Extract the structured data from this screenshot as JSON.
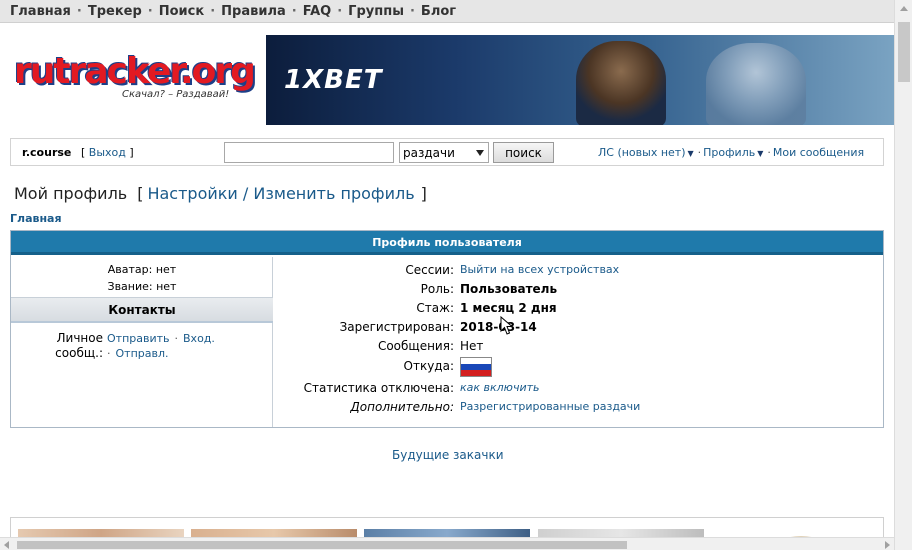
{
  "topnav": {
    "items": [
      "Главная",
      "Трекер",
      "Поиск",
      "Правила",
      "FAQ",
      "Группы",
      "Блог"
    ],
    "separator": "·"
  },
  "logo": {
    "brand": "rutracker.org",
    "slogan": "Скачал? – Раздавай!"
  },
  "banner": {
    "text": "1XBET"
  },
  "searchbar": {
    "username": "r.course",
    "logout_open": "[",
    "logout_label": "Выход",
    "logout_close": "]",
    "query_value": "",
    "scope_value": "раздачи",
    "search_button": "поиск",
    "pm_link": "ЛС (новых нет)",
    "profile_link": "Профиль",
    "messages_link": "Мои сообщения"
  },
  "page": {
    "title": "Мой профиль",
    "settings_link": "Настройки / Изменить профиль",
    "breadcrumb": "Главная"
  },
  "profile": {
    "header": "Профиль пользователя",
    "avatar": "Аватар: нет",
    "rank": "Звание: нет",
    "contacts_header": "Контакты",
    "pm_label": "Личное сообщ.:",
    "pm_send": "Отправить",
    "pm_inbox": "Вход.",
    "pm_sent": "Отправл.",
    "rows": [
      {
        "key": "Сессии:",
        "value": "Выйти на всех устройствах"
      },
      {
        "key": "Роль:",
        "value": "Пользователь"
      },
      {
        "key": "Стаж:",
        "value": "1 месяц 2 дня"
      },
      {
        "key": "Зарегистрирован:",
        "value": "2018-03-14"
      },
      {
        "key": "Сообщения:",
        "value": "Нет"
      },
      {
        "key": "Откуда:",
        "value": ""
      },
      {
        "key": "Статистика отключена:",
        "value": "как включить"
      },
      {
        "key": "Дополнительно:",
        "value": "Разрегистрированные раздачи"
      }
    ]
  },
  "future_downloads": "Будущие закачки",
  "colors": {
    "header_blue": "#1f7aab",
    "link": "#1a5a8a",
    "logo_red": "#e21a22",
    "logo_navy": "#1d3f88"
  }
}
